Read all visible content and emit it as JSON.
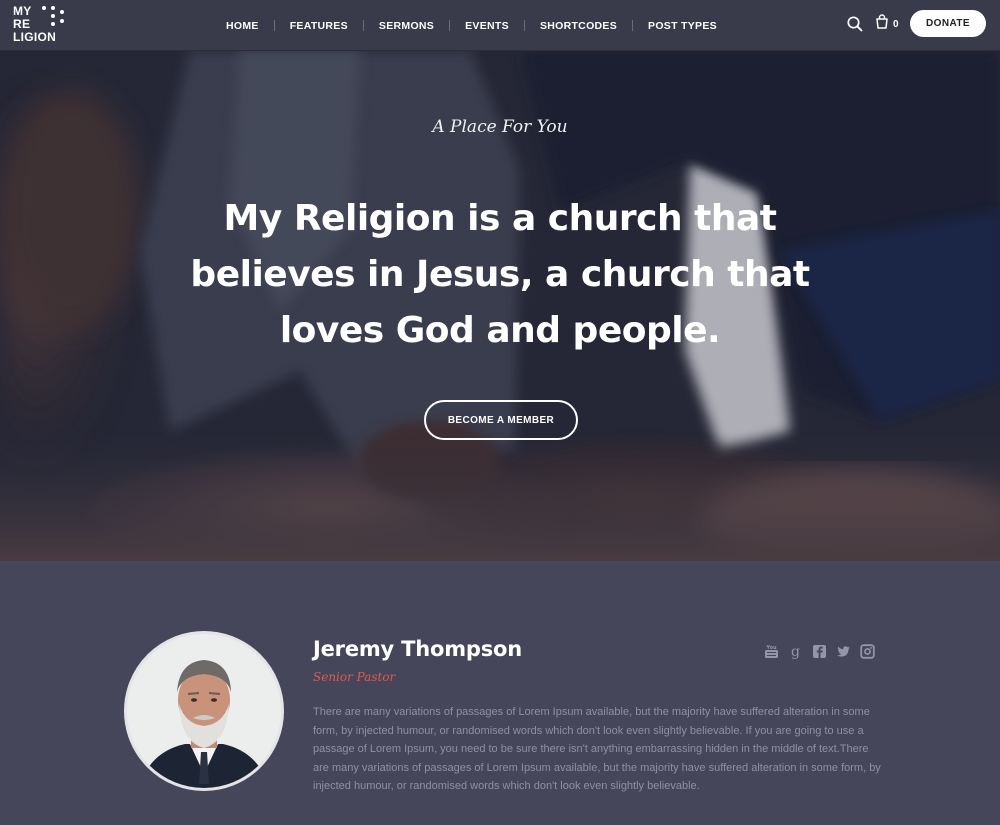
{
  "logo": {
    "line1": "MY",
    "line2": "RE",
    "line3": "LIGION"
  },
  "nav": {
    "items": [
      "HOME",
      "FEATURES",
      "SERMONS",
      "EVENTS",
      "SHORTCODES",
      "POST TYPES"
    ]
  },
  "header": {
    "cart_count": "0",
    "donate_label": "DONATE",
    "search_icon": "search-icon",
    "cart_icon": "cart-icon"
  },
  "hero": {
    "kicker": "A Place For You",
    "title": "My Religion is a church that believes in Jesus, a church that loves God and people.",
    "cta_label": "BECOME A MEMBER"
  },
  "pastor": {
    "name": "Jeremy Thompson",
    "role": "Senior Pastor",
    "bio": "There are many variations of passages of Lorem Ipsum available, but the majority have suffered alteration in some form, by injected humour, or randomised words which don't look even slightly believable. If you are going to use a passage of Lorem Ipsum, you need to be sure there isn't anything embarrassing hidden in the middle of text.There are many variations of passages of Lorem Ipsum available, but the majority have suffered alteration in some form, by injected humour, or randomised words which don't look even slightly believable.",
    "socials": [
      "youtube-icon",
      "google-plus-icon",
      "facebook-icon",
      "twitter-icon",
      "instagram-icon"
    ]
  },
  "colors": {
    "header_bg": "#3a3b4a",
    "section_bg": "#45465a",
    "accent": "#e05a4c",
    "bio_text": "#8f90a0"
  }
}
